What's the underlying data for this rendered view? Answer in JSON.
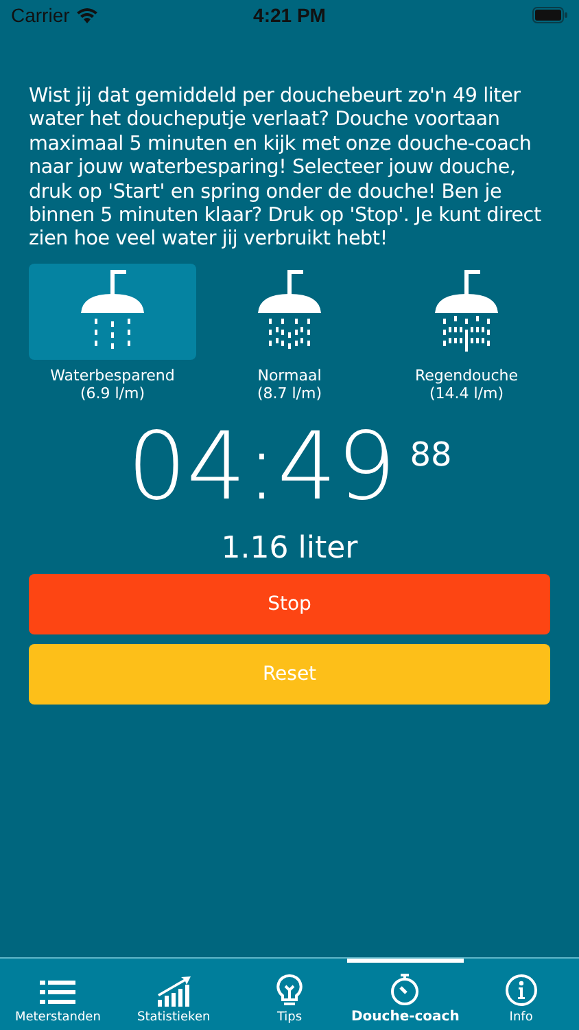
{
  "status_bar": {
    "carrier": "Carrier",
    "time": "4:21 PM"
  },
  "intro": "Wist jij dat gemiddeld per douchebeurt zo'n 49 liter water het doucheputje verlaat? Douche voortaan maximaal 5 minuten en kijk met onze douche-coach naar jouw waterbesparing! Selecteer jouw douche, druk op 'Start' en spring onder de douche! Ben je binnen 5 minuten klaar? Druk op 'Stop'. Je kunt direct zien hoe veel water jij verbruikt hebt!",
  "showers": [
    {
      "name": "Waterbesparend",
      "rate": "(6.9 l/m)",
      "selected": true
    },
    {
      "name": "Normaal",
      "rate": "(8.7 l/m)",
      "selected": false
    },
    {
      "name": "Regendouche",
      "rate": "(14.4 l/m)",
      "selected": false
    }
  ],
  "timer": {
    "time": "04:49",
    "hundredths": "88"
  },
  "volume": "1.16 liter",
  "buttons": [
    {
      "label": "Stop",
      "kind": "stop"
    },
    {
      "label": "Reset",
      "kind": "reset"
    }
  ],
  "tabs": [
    {
      "label": "Meterstanden",
      "kind": "list",
      "selected": false
    },
    {
      "label": "Statistieken",
      "kind": "chart",
      "selected": false
    },
    {
      "label": "Tips",
      "kind": "bulb",
      "selected": false
    },
    {
      "label": "Douche-coach",
      "kind": "stopwatch",
      "selected": true
    },
    {
      "label": "Info",
      "kind": "info",
      "selected": false
    }
  ]
}
